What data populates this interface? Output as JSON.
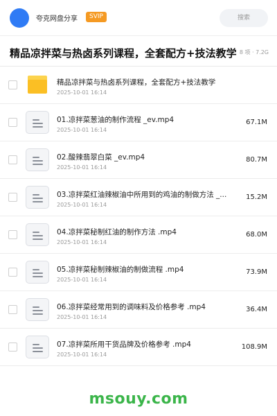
{
  "header": {
    "app_name": "夸克网盘分享",
    "badge": "SVIP",
    "search_placeholder": "搜索"
  },
  "title_bar": {
    "title": "精品凉拌菜与热卤系列课程，全套配方+技法教学",
    "meta": "8 项 · 7.2G"
  },
  "items": [
    {
      "type": "folder",
      "name": "精品凉拌菜与热卤系列课程，全套配方+技法教学",
      "date": "2025-10-01 16:14",
      "size": ""
    },
    {
      "type": "file",
      "name": "01.凉拌菜葱油的制作流程 _ev.mp4",
      "date": "2025-10-01 16:14",
      "size": "67.1M"
    },
    {
      "type": "file",
      "name": "02.酸辣翡翠白菜 _ev.mp4",
      "date": "2025-10-01 16:14",
      "size": "80.7M"
    },
    {
      "type": "file",
      "name": "03.凉拌菜红油辣椒油中所用到的鸡油的制做方法 _...",
      "date": "2025-10-01 16:14",
      "size": "15.2M"
    },
    {
      "type": "file",
      "name": "04.凉拌菜秘制红油的制作方法 .mp4",
      "date": "2025-10-01 16:14",
      "size": "68.0M"
    },
    {
      "type": "file",
      "name": "05.凉拌菜秘制辣椒油的制做流程 .mp4",
      "date": "2025-10-01 16:14",
      "size": "73.9M"
    },
    {
      "type": "file",
      "name": "06.凉拌菜经常用到的调味料及价格参考 .mp4",
      "date": "2025-10-01 16:14",
      "size": "36.4M"
    },
    {
      "type": "file",
      "name": "07.凉拌菜所用干货品牌及价格参考 .mp4",
      "date": "2025-10-01 16:14",
      "size": "108.9M"
    }
  ],
  "watermark": "msouy.com",
  "colors": {
    "accent": "#2f7bf5",
    "badge": "#f59a23",
    "folder": "#fbbf24",
    "watermark": "#3bb54a"
  }
}
